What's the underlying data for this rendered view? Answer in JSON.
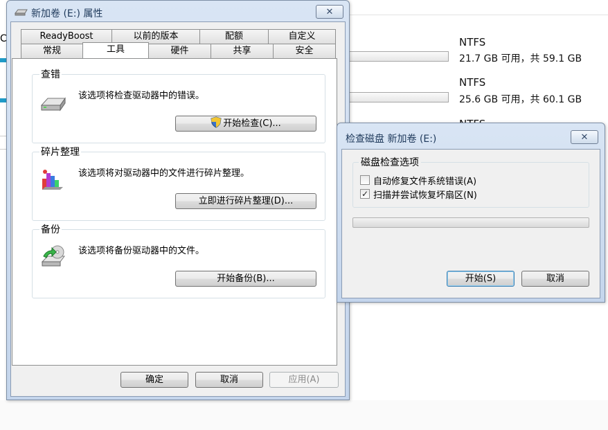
{
  "explorer": {
    "drives": [
      {
        "fs": "NTFS",
        "capacity": "21.7 GB 可用，共 59.1 GB"
      },
      {
        "fs": "NTFS",
        "capacity": "25.6 GB 可用，共 60.1 GB"
      },
      {
        "fs": "NTFS"
      }
    ],
    "left_fragment": "C"
  },
  "properties": {
    "title": "新加卷 (E:) 属性",
    "close_label": "✕",
    "tabs_row1": [
      "ReadyBoost",
      "以前的版本",
      "配额",
      "自定义"
    ],
    "tabs_row2": [
      "常规",
      "工具",
      "硬件",
      "共享",
      "安全"
    ],
    "active_tab": "工具",
    "sections": [
      {
        "label": "查错",
        "desc": "该选项将检查驱动器中的错误。",
        "button": "开始检查(C)...",
        "icon": "drive-check-icon"
      },
      {
        "label": "碎片整理",
        "desc": "该选项将对驱动器中的文件进行碎片整理。",
        "button": "立即进行碎片整理(D)...",
        "icon": "defrag-icon"
      },
      {
        "label": "备份",
        "desc": "该选项将备份驱动器中的文件。",
        "button": "开始备份(B)...",
        "icon": "backup-icon"
      }
    ],
    "buttons": {
      "ok": "确定",
      "cancel": "取消",
      "apply": "应用(A)"
    }
  },
  "checkdisk": {
    "title": "检查磁盘 新加卷 (E:)",
    "close_label": "✕",
    "group_label": "磁盘检查选项",
    "options": [
      {
        "label": "自动修复文件系统错误(A)",
        "checked": false
      },
      {
        "label": "扫描并尝试恢复坏扇区(N)",
        "checked": true
      }
    ],
    "progress": 0,
    "buttons": {
      "start": "开始(S)",
      "cancel": "取消"
    }
  },
  "colors": {
    "title_text": "#1e395b",
    "window_frame": "#c4d5ec",
    "client": "#f0f0f0"
  }
}
